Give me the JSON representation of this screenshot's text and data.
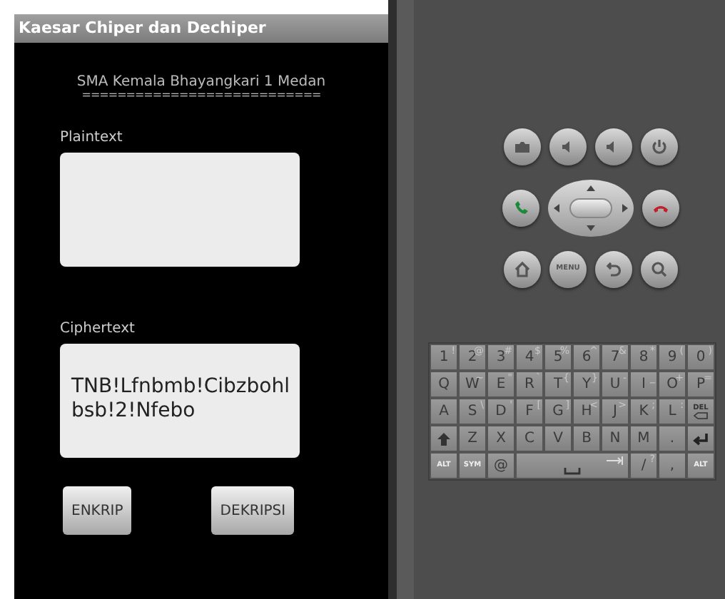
{
  "app": {
    "title": "Kaesar Chiper dan Dechiper",
    "subtitle": "SMA Kemala Bhayangkari 1 Medan",
    "underline": "===========================",
    "plaintext": {
      "label": "Plaintext"
    },
    "ciphertext": {
      "label": "Ciphertext",
      "value": "TNB!Lfnbmb!Cibzbohl bsb!2!Nfebo"
    },
    "buttons": [
      {
        "label": "ENKRIP"
      },
      {
        "label": "DEKRIPSI"
      }
    ]
  },
  "emulator": {
    "menu_key": "MENU",
    "keyboard": [
      [
        {
          "kind": "char",
          "label": "1",
          "alt": "!"
        },
        {
          "kind": "char",
          "label": "2",
          "alt": "@"
        },
        {
          "kind": "char",
          "label": "3",
          "alt": "#"
        },
        {
          "kind": "char",
          "label": "4",
          "alt": "$"
        },
        {
          "kind": "char",
          "label": "5",
          "alt": "%"
        },
        {
          "kind": "char",
          "label": "6",
          "alt": "^"
        },
        {
          "kind": "char",
          "label": "7",
          "alt": "&"
        },
        {
          "kind": "char",
          "label": "8",
          "alt": "*"
        },
        {
          "kind": "char",
          "label": "9",
          "alt": "("
        },
        {
          "kind": "char",
          "label": "0",
          "alt": ")"
        }
      ],
      [
        {
          "kind": "char",
          "label": "Q"
        },
        {
          "kind": "char",
          "label": "W",
          "alt": "~"
        },
        {
          "kind": "char",
          "label": "E",
          "alt": "\""
        },
        {
          "kind": "char",
          "label": "R",
          "alt": "`"
        },
        {
          "kind": "char",
          "label": "T",
          "alt": "{"
        },
        {
          "kind": "char",
          "label": "Y",
          "alt": "}"
        },
        {
          "kind": "char",
          "label": "U",
          "alt": "-"
        },
        {
          "kind": "char",
          "label": "I",
          "alt": "_"
        },
        {
          "kind": "char",
          "label": "O",
          "alt": "+"
        },
        {
          "kind": "char",
          "label": "P",
          "alt": "="
        }
      ],
      [
        {
          "kind": "char",
          "label": "A"
        },
        {
          "kind": "char",
          "label": "S",
          "alt": "\\"
        },
        {
          "kind": "char",
          "label": "D",
          "alt": "'"
        },
        {
          "kind": "char",
          "label": "F",
          "alt": "["
        },
        {
          "kind": "char",
          "label": "G",
          "alt": "]"
        },
        {
          "kind": "char",
          "label": "H",
          "alt": "<"
        },
        {
          "kind": "char",
          "label": "J",
          "alt": ">"
        },
        {
          "kind": "char",
          "label": "K",
          "alt": ";"
        },
        {
          "kind": "char",
          "label": "L",
          "alt": ":"
        },
        {
          "kind": "del",
          "label": "DEL"
        }
      ],
      [
        {
          "kind": "shift"
        },
        {
          "kind": "char",
          "label": "Z"
        },
        {
          "kind": "char",
          "label": "X"
        },
        {
          "kind": "char",
          "label": "C"
        },
        {
          "kind": "char",
          "label": "V"
        },
        {
          "kind": "char",
          "label": "B"
        },
        {
          "kind": "char",
          "label": "N"
        },
        {
          "kind": "char",
          "label": "M"
        },
        {
          "kind": "char",
          "label": "."
        },
        {
          "kind": "enter"
        }
      ],
      [
        {
          "kind": "small",
          "label": "ALT"
        },
        {
          "kind": "small",
          "label": "SYM"
        },
        {
          "kind": "char",
          "label": "@"
        },
        {
          "kind": "space"
        },
        {
          "kind": "char",
          "label": "/",
          "alt": "?"
        },
        {
          "kind": "char",
          "label": ","
        },
        {
          "kind": "small",
          "label": "ALT"
        }
      ]
    ]
  }
}
